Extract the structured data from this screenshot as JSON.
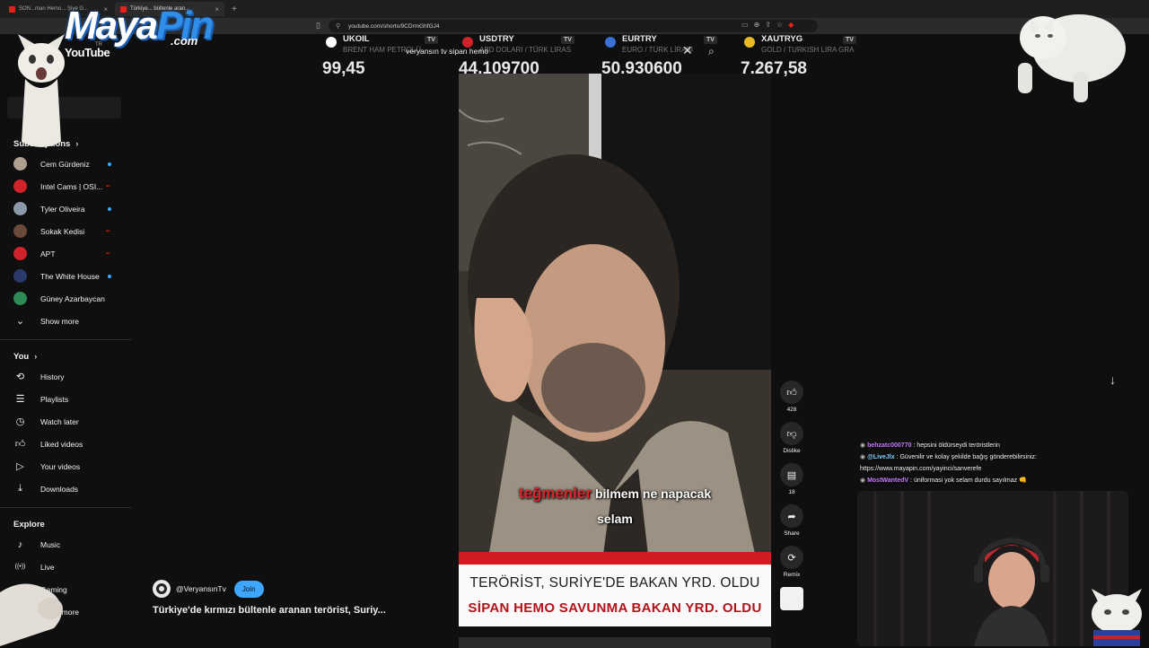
{
  "browser": {
    "tabs": [
      {
        "label": "SON...man Hemo... Şiye G...",
        "active": false
      },
      {
        "label": "Türkiye... bültenle aran...",
        "active": true
      }
    ],
    "url": "youtube.com/shorts/9CDrmGhfGJ4"
  },
  "overlay": {
    "logo_main": "Maya",
    "logo_accent": "Pin",
    "logo_com": ".com"
  },
  "youtube": {
    "logo_text": "YouTube",
    "region": "TR",
    "search_query": "veryansın tv sipan hemo"
  },
  "sidebar": {
    "subscriptions_title": "Subscriptions",
    "subscriptions": [
      {
        "name": "Cem Gürdeniz",
        "color": "#b0a090",
        "indicator": "dot"
      },
      {
        "name": "Intel Cams | OSI...",
        "color": "#d2232a",
        "indicator": "live"
      },
      {
        "name": "Tyler Oliveira",
        "color": "#8a9aa8",
        "indicator": "dot"
      },
      {
        "name": "Sokak Kedisi",
        "color": "#6a4a3a",
        "indicator": "live"
      },
      {
        "name": "APT",
        "color": "#d2232a",
        "indicator": "live"
      },
      {
        "name": "The White House",
        "color": "#2b3a6a",
        "indicator": "dot"
      },
      {
        "name": "Güney Azarbaycan",
        "color": "#2e8b57",
        "indicator": "none"
      }
    ],
    "show_more": "Show more",
    "you_title": "You",
    "you_items": [
      {
        "label": "History",
        "icon": "history-icon"
      },
      {
        "label": "Playlists",
        "icon": "playlists-icon"
      },
      {
        "label": "Watch later",
        "icon": "clock-icon"
      },
      {
        "label": "Liked videos",
        "icon": "thumb-up-icon"
      },
      {
        "label": "Your videos",
        "icon": "play-icon"
      },
      {
        "label": "Downloads",
        "icon": "download-icon"
      }
    ],
    "explore_title": "Explore",
    "explore_items": [
      {
        "label": "Music",
        "icon": "music-icon"
      },
      {
        "label": "Live",
        "icon": "live-icon"
      },
      {
        "label": "Gaming",
        "icon": "gaming-icon"
      }
    ],
    "explore_show_more": "Show more"
  },
  "ticker": [
    {
      "symbol": "UKOIL",
      "name": "BRENT HAM PETROLÜ",
      "value": "99,45",
      "color": "#ffffff"
    },
    {
      "symbol": "USDTRY",
      "name": "ABD DOLARI / TÜRK LİRAS",
      "value": "44,109700",
      "color": "#d2232a"
    },
    {
      "symbol": "EURTRY",
      "name": "EURO / TÜRK LİRASI",
      "value": "50,930600",
      "color": "#3b6fd6"
    },
    {
      "symbol": "XAUTRYG",
      "name": "GOLD / TURKISH LIRA GRA",
      "value": "7.267,58",
      "color": "#e8b923"
    }
  ],
  "ticker_badge": "TV",
  "short": {
    "caption_red": "teğmenler",
    "caption_rest": "bilmem ne napacak",
    "caption_line2": "selam",
    "banner_line1": "TERÖRİST, SURİYE'DE BAKAN YRD. OLDU",
    "banner_line2": "SİPAN HEMO SAVUNMA BAKAN YRD. OLDU",
    "channel": "@VeryansınTv",
    "join_label": "Join",
    "title": "Türkiye'de kırmızı bültenle aranan terörist, Suriy..."
  },
  "actions": {
    "like_count": "428",
    "dislike_label": "Dislike",
    "comment_count": "18",
    "share_label": "Share",
    "remix_label": "Remix"
  },
  "chat": [
    {
      "user": "behzatc000770",
      "user_color": "#c77dff",
      "text": "hepsini öldürseydi teröristlerin"
    },
    {
      "user": "@LiveJlx",
      "user_color": "#7fd6ff",
      "text": "Güvenilir ve kolay şekilde bağış gönderebilirsiniz: https://www.mayapin.com/yayinci/sanverefe"
    },
    {
      "user": "MostWantedV",
      "user_color": "#c77dff",
      "text": "üniformasi yok selam durdu sayılmaz 👊"
    }
  ]
}
